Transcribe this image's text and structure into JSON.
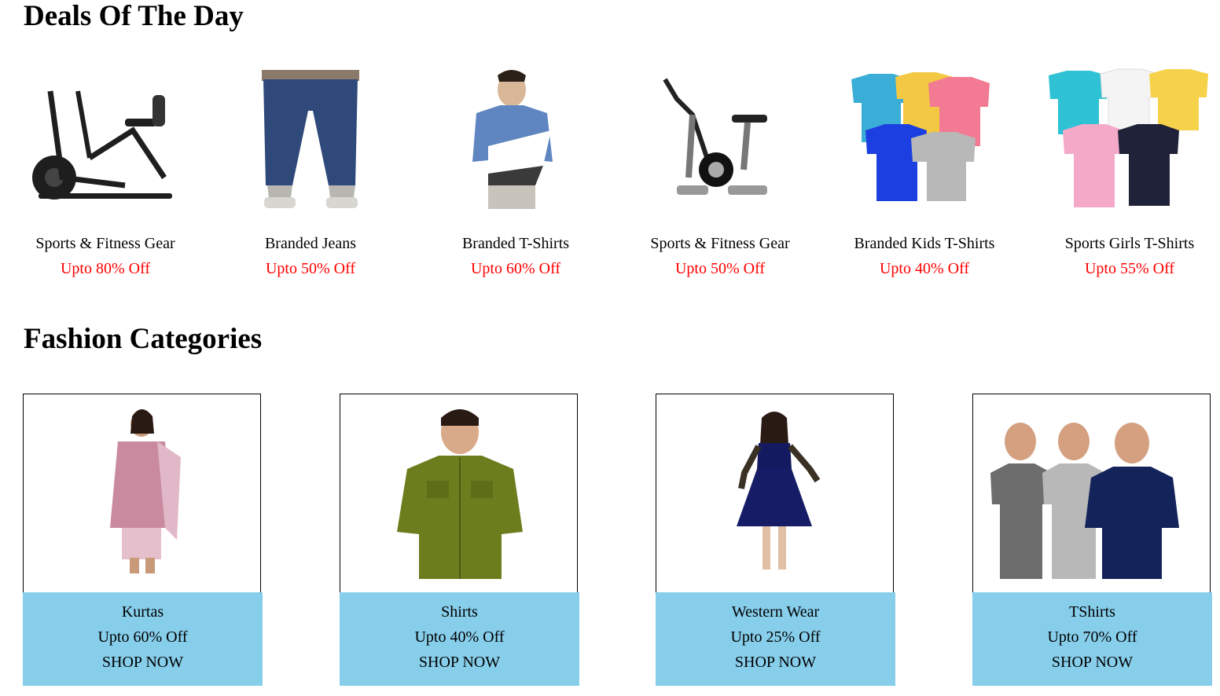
{
  "deals": {
    "title": "Deals Of The Day",
    "items": [
      {
        "name": "Sports & Fitness Gear",
        "offer": "Upto 80% Off",
        "icon": "air-bike-image"
      },
      {
        "name": "Branded Jeans",
        "offer": "Upto 50% Off",
        "icon": "jeans-image"
      },
      {
        "name": "Branded T-Shirts",
        "offer": "Upto 60% Off",
        "icon": "polo-tshirt-image"
      },
      {
        "name": "Sports & Fitness Gear",
        "offer": "Upto 50% Off",
        "icon": "exercise-bike-image"
      },
      {
        "name": "Branded Kids T-Shirts",
        "offer": "Upto 40% Off",
        "icon": "kids-tshirts-image"
      },
      {
        "name": "Sports Girls T-Shirts",
        "offer": "Upto 55% Off",
        "icon": "girls-tshirts-image"
      }
    ],
    "offer_color": "#ff0000"
  },
  "fashion": {
    "title": "Fashion Categories",
    "items": [
      {
        "name": "Kurtas",
        "offer": "Upto 60% Off",
        "cta": "SHOP NOW",
        "icon": "kurta-image"
      },
      {
        "name": "Shirts",
        "offer": "Upto 40% Off",
        "cta": "SHOP NOW",
        "icon": "shirt-image"
      },
      {
        "name": "Western Wear",
        "offer": "Upto 25% Off",
        "cta": "SHOP NOW",
        "icon": "western-dress-image"
      },
      {
        "name": "TShirts",
        "offer": "Upto 70% Off",
        "cta": "SHOP NOW",
        "icon": "tshirts-image"
      }
    ],
    "panel_color": "#87ceeb"
  }
}
